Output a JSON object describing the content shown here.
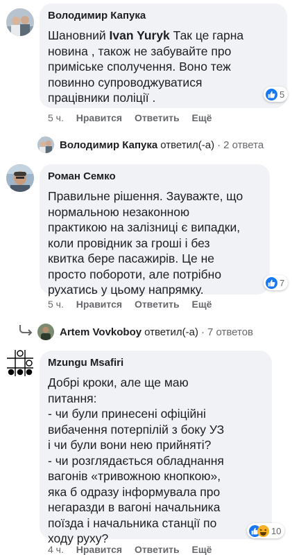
{
  "comments": [
    {
      "author": "Володимир Капука",
      "text_prefix": "Шановний ",
      "mention": "Ivan Yuryk",
      "text_lines_after_mention": " Так це гарна",
      "text_rest": [
        "новина , також не забувайте про",
        "приміське сполучення. Воно теж",
        "повинно супроводжуватися",
        "працівники поліції ."
      ],
      "reaction_count": "5",
      "reaction_type": "like-icon",
      "time": "5 ч.",
      "actions": [
        "Нравится",
        "Ответить",
        "Ещё"
      ],
      "replies": {
        "name": "Володимир Капука",
        "verb": "ответил(-а)",
        "dot": "·",
        "count": "2 ответа"
      }
    },
    {
      "author": "Роман Семко",
      "text_lines": [
        "Правильне рішення. Зауважте, що",
        "нормальною незаконною",
        "практикою на залізниці є випадки,",
        "коли провідник за гроші і без",
        "квитка бере пасажирів. Це не",
        "просто побороти, але потрібно",
        "рухатись у цьому напрямку."
      ],
      "reaction_count": "7",
      "reaction_type": "like-icon",
      "time": "5 ч.",
      "actions": [
        "Нравится",
        "Ответить",
        "Ещё"
      ],
      "replies": {
        "name": "Artem Vovkoboy",
        "verb": "ответил(-а)",
        "dot": "·",
        "count": "7 ответов"
      }
    },
    {
      "author": "Mzungu Msafiri",
      "text_lines": [
        "Добрі кроки, але ще маю",
        "питання:",
        "- чи були принесені офіційні",
        "вибачення потерпілій з боку УЗ",
        "і чи були вони нею прийняті?",
        "- чи розглядається обладнання",
        "вагонів «тривожною кнопкою»,",
        "яка б одразу інформувала про",
        "негаразди в вагоні начальника",
        "поїзда і начальника станції по",
        "ходу руху?"
      ],
      "reaction_count": "10",
      "reaction_type": "like-and-haha-icons",
      "time": "4 ч.",
      "actions": [
        "Нравится",
        "Ответить",
        "Ещё"
      ]
    }
  ],
  "colors": {
    "bubble": "#f0f2f5",
    "meta": "#65676b",
    "like": "#1877f2",
    "haha": "#f7b125"
  }
}
